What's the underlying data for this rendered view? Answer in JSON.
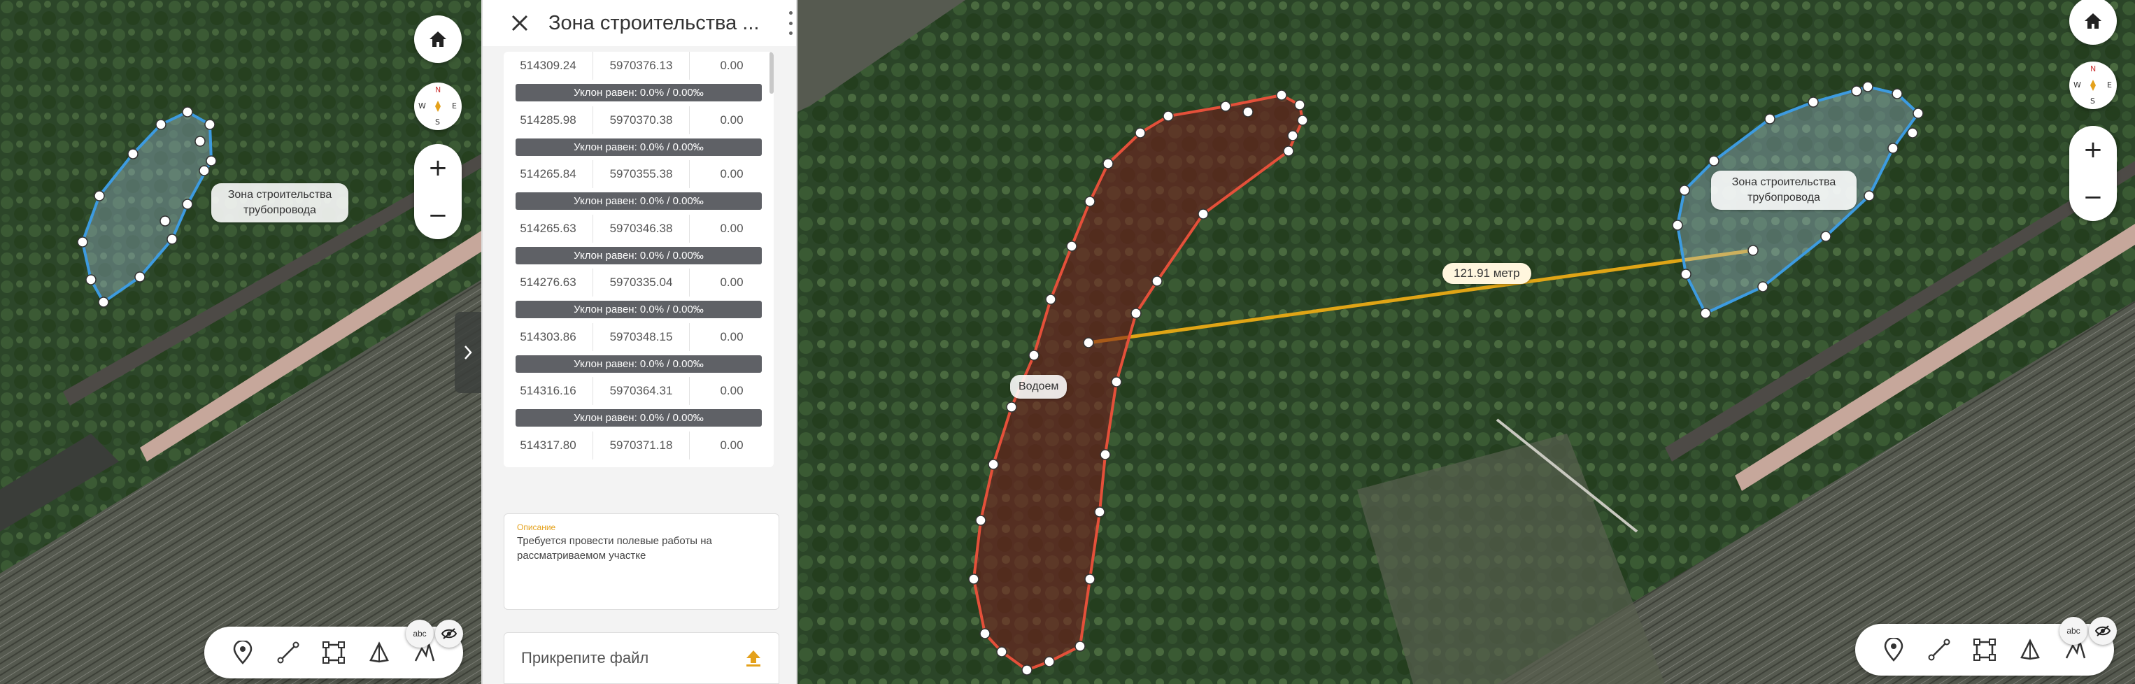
{
  "panel": {
    "title": "Зона строительства ...",
    "rows": [
      {
        "x": "514309.24",
        "y": "5970376.13",
        "z": "0.00"
      },
      {
        "x": "514285.98",
        "y": "5970370.38",
        "z": "0.00"
      },
      {
        "x": "514265.84",
        "y": "5970355.38",
        "z": "0.00"
      },
      {
        "x": "514265.63",
        "y": "5970346.38",
        "z": "0.00"
      },
      {
        "x": "514276.63",
        "y": "5970335.04",
        "z": "0.00"
      },
      {
        "x": "514303.86",
        "y": "5970348.15",
        "z": "0.00"
      },
      {
        "x": "514316.16",
        "y": "5970364.31",
        "z": "0.00"
      },
      {
        "x": "514317.80",
        "y": "5970371.18",
        "z": "0.00"
      }
    ],
    "slope_label": "Уклон равен: 0.0% / 0.00‰",
    "description_label": "Описание",
    "description_text": "Требуется провести полевые работы на рассматриваемом участке",
    "attach_label": "Прикрепите файл"
  },
  "map": {
    "zone_label": "Зона строительства трубопровода",
    "water_label": "Водоем",
    "distance_label": "121.91 метр",
    "compass": {
      "n": "N",
      "s": "S",
      "w": "W",
      "e": "E"
    },
    "zoom_in": "+",
    "zoom_out": "−",
    "abc_badge": "abc"
  },
  "colors": {
    "zone_stroke": "#3d9be0",
    "water_stroke": "#e4503a",
    "distance_line": "#e0a516",
    "accent": "#e4a11b"
  }
}
